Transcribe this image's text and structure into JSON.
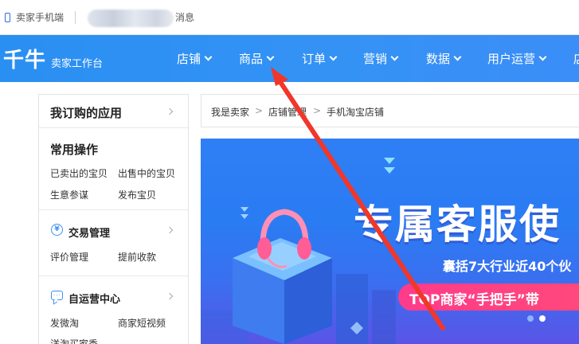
{
  "topbar": {
    "seller_mobile": "卖家手机端",
    "messages": "消息"
  },
  "nav": {
    "logo": "千牛",
    "workbench": "卖家工作台",
    "items": [
      {
        "label": "店铺"
      },
      {
        "label": "商品"
      },
      {
        "label": "订单"
      },
      {
        "label": "营销"
      },
      {
        "label": "数据"
      },
      {
        "label": "用户运营"
      },
      {
        "label": "店"
      }
    ]
  },
  "sidebar": {
    "header": "我订购的应用",
    "common": {
      "title": "常用操作",
      "links": [
        "已卖出的宝贝",
        "出售中的宝贝",
        "生意参谋",
        "发布宝贝"
      ]
    },
    "trade": {
      "icon": "yen-circle-icon",
      "title": "交易管理",
      "links": [
        "评价管理",
        "提前收款"
      ]
    },
    "self_ops": {
      "icon": "chat-bubble-icon",
      "title": "自运营中心",
      "links": [
        "发微淘",
        "商家短视频",
        "洋淘买家秀"
      ]
    }
  },
  "breadcrumb": [
    "我是卖家",
    "店铺管理",
    "手机淘宝店铺"
  ],
  "banner": {
    "headline": "专属客服使",
    "subline": "囊括7大行业近40个伙",
    "pill_text": "TOP商家“手把手”带"
  },
  "colors": {
    "nav_blue": "#2a8ff2",
    "banner_blue": "#2f7ef5",
    "pill_pink": "#ff3b8a",
    "annotation_red": "#f0372a",
    "icon_blue": "#3a8ef3"
  }
}
